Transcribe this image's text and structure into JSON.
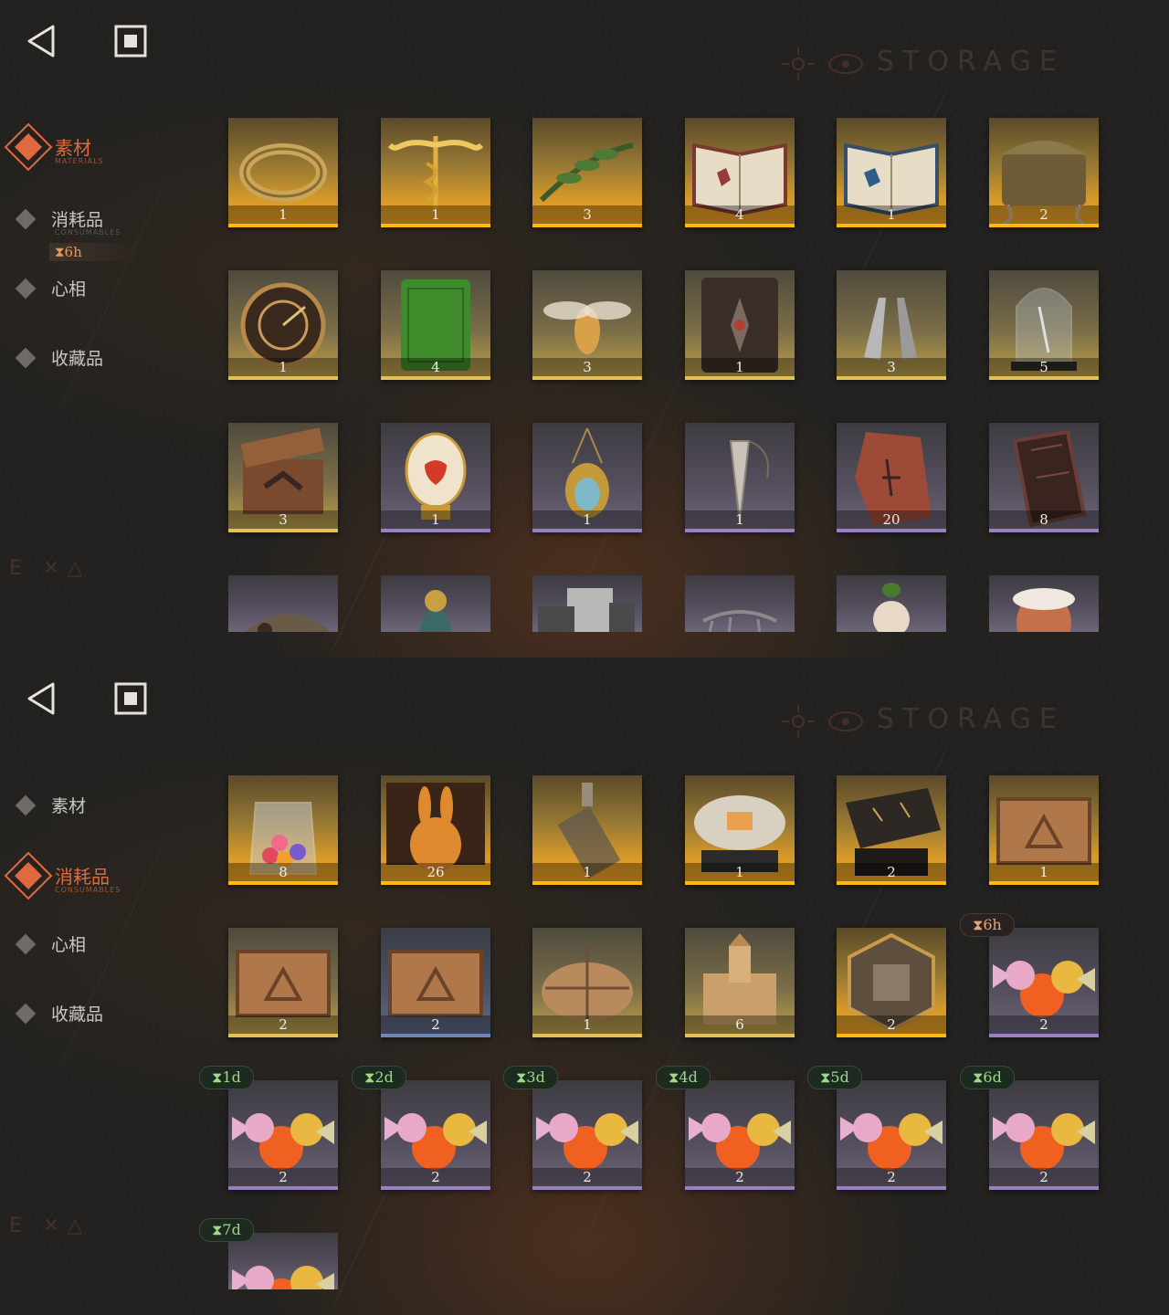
{
  "panels": [
    {
      "watermark": "STORAGE",
      "nav": [
        {
          "label": "素材",
          "sub": "MATERIALS",
          "active": true
        },
        {
          "label": "消耗品",
          "sub": "CONSUMABLES",
          "active": false
        },
        {
          "label": "心相",
          "sub": "",
          "active": false
        },
        {
          "label": "收藏品",
          "sub": "",
          "active": false
        }
      ],
      "timer": "6h",
      "items": [
        {
          "name": "ring",
          "qty": "1",
          "rarity": "gold"
        },
        {
          "name": "caduceus",
          "qty": "1",
          "rarity": "gold"
        },
        {
          "name": "laurel-branch",
          "qty": "3",
          "rarity": "gold"
        },
        {
          "name": "red-book",
          "qty": "4",
          "rarity": "gold"
        },
        {
          "name": "blue-book",
          "qty": "1",
          "rarity": "gold"
        },
        {
          "name": "root-chest",
          "qty": "2",
          "rarity": "gold"
        },
        {
          "name": "astrolabe",
          "qty": "1",
          "rarity": "yellow"
        },
        {
          "name": "green-tablet",
          "qty": "4",
          "rarity": "yellow"
        },
        {
          "name": "firefly",
          "qty": "3",
          "rarity": "yellow"
        },
        {
          "name": "leather-tome",
          "qty": "1",
          "rarity": "yellow"
        },
        {
          "name": "bullets",
          "qty": "3",
          "rarity": "yellow"
        },
        {
          "name": "glass-dome",
          "qty": "5",
          "rarity": "yellow"
        },
        {
          "name": "hand-box",
          "qty": "3",
          "rarity": "yellow"
        },
        {
          "name": "jeweled-egg",
          "qty": "1",
          "rarity": "purple"
        },
        {
          "name": "beetle-pendant",
          "qty": "1",
          "rarity": "purple"
        },
        {
          "name": "crystal-pendulum",
          "qty": "1",
          "rarity": "purple"
        },
        {
          "name": "stone-fragment",
          "qty": "20",
          "rarity": "purple"
        },
        {
          "name": "coffin-box",
          "qty": "8",
          "rarity": "purple"
        },
        {
          "name": "iron",
          "qty": "",
          "rarity": "purple"
        },
        {
          "name": "bird-figurine",
          "qty": "",
          "rarity": "purple"
        },
        {
          "name": "silver-bars",
          "qty": "",
          "rarity": "purple"
        },
        {
          "name": "skeleton",
          "qty": "",
          "rarity": "purple"
        },
        {
          "name": "plush-toy",
          "qty": "",
          "rarity": "purple"
        },
        {
          "name": "mask",
          "qty": "",
          "rarity": "purple"
        }
      ]
    },
    {
      "watermark": "STORAGE",
      "nav": [
        {
          "label": "素材",
          "sub": "",
          "active": false
        },
        {
          "label": "消耗品",
          "sub": "CONSUMABLES",
          "active": true
        },
        {
          "label": "心相",
          "sub": "",
          "active": false
        },
        {
          "label": "收藏品",
          "sub": "",
          "active": false
        }
      ],
      "items": [
        {
          "name": "candy-jar",
          "qty": "8",
          "rarity": "gold",
          "badge": ""
        },
        {
          "name": "golden-rabbit",
          "qty": "26",
          "rarity": "gold",
          "badge": ""
        },
        {
          "name": "bottle",
          "qty": "1",
          "rarity": "gold",
          "badge": ""
        },
        {
          "name": "capsule-machine",
          "qty": "1",
          "rarity": "gold",
          "badge": ""
        },
        {
          "name": "rune-table",
          "qty": "2",
          "rarity": "gold",
          "badge": ""
        },
        {
          "name": "wooden-crate-gold",
          "qty": "1",
          "rarity": "gold",
          "badge": ""
        },
        {
          "name": "wooden-crate-yellow",
          "qty": "2",
          "rarity": "yellow",
          "badge": ""
        },
        {
          "name": "wooden-crate-blue",
          "qty": "2",
          "rarity": "blue",
          "badge": ""
        },
        {
          "name": "parcel",
          "qty": "1",
          "rarity": "yellow",
          "badge": ""
        },
        {
          "name": "sand-castle",
          "qty": "6",
          "rarity": "yellow",
          "badge": ""
        },
        {
          "name": "hex-puzzle",
          "qty": "2",
          "rarity": "gold",
          "badge": ""
        },
        {
          "name": "candies",
          "qty": "2",
          "rarity": "purple",
          "badge": "6h"
        },
        {
          "name": "candies",
          "qty": "2",
          "rarity": "purple",
          "badge": "1d"
        },
        {
          "name": "candies",
          "qty": "2",
          "rarity": "purple",
          "badge": "2d"
        },
        {
          "name": "candies",
          "qty": "2",
          "rarity": "purple",
          "badge": "3d"
        },
        {
          "name": "candies",
          "qty": "2",
          "rarity": "purple",
          "badge": "4d"
        },
        {
          "name": "candies",
          "qty": "2",
          "rarity": "purple",
          "badge": "5d"
        },
        {
          "name": "candies",
          "qty": "2",
          "rarity": "purple",
          "badge": "6d"
        },
        {
          "name": "candies",
          "qty": "",
          "rarity": "purple",
          "badge": "7d"
        }
      ]
    }
  ],
  "badge_symbol": "⧗"
}
